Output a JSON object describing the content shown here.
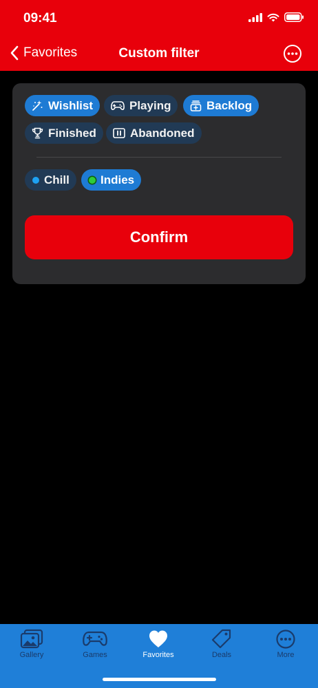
{
  "status_bar": {
    "time": "09:41"
  },
  "nav": {
    "back_label": "Favorites",
    "title": "Custom filter"
  },
  "filters": {
    "status_chips": [
      {
        "label": "Wishlist",
        "icon": "sparkles-icon",
        "selected": true
      },
      {
        "label": "Playing",
        "icon": "gamepad-icon",
        "selected": false
      },
      {
        "label": "Backlog",
        "icon": "backlog-icon",
        "selected": true
      },
      {
        "label": "Finished",
        "icon": "trophy-icon",
        "selected": false
      },
      {
        "label": "Abandoned",
        "icon": "pause-icon",
        "selected": false
      }
    ],
    "tag_chips": [
      {
        "label": "Chill",
        "color": "#1ea1f2",
        "selected": false
      },
      {
        "label": "Indies",
        "color": "#2ecc3a",
        "selected": true
      }
    ]
  },
  "confirm_label": "Confirm",
  "tabbar": {
    "items": [
      {
        "label": "Gallery",
        "icon": "gallery-icon",
        "active": false
      },
      {
        "label": "Games",
        "icon": "gamepad-icon",
        "active": false
      },
      {
        "label": "Favorites",
        "icon": "heart-icon",
        "active": true
      },
      {
        "label": "Deals",
        "icon": "tag-icon",
        "active": false
      },
      {
        "label": "More",
        "icon": "more-icon",
        "active": false
      }
    ]
  },
  "colors": {
    "brand_red": "#e8000b",
    "chip_selected": "#1e7bd4",
    "chip_unselected": "#213a55",
    "tabbar_blue": "#1f7fd8"
  }
}
